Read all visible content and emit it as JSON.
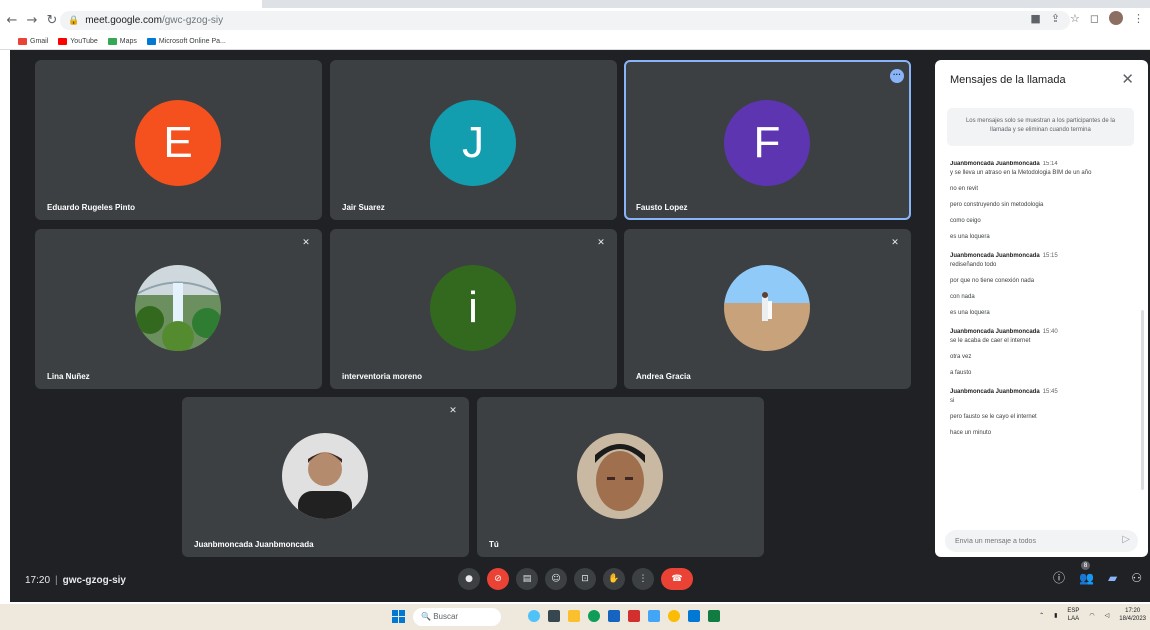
{
  "browser": {
    "url_host": "meet.google.com",
    "url_path": "/gwc-gzog-siy",
    "bookmarks": [
      {
        "label": "Gmail",
        "color": "#ea4335"
      },
      {
        "label": "YouTube",
        "color": "#ff0000"
      },
      {
        "label": "Maps",
        "color": "#34a853"
      },
      {
        "label": "Microsoft Online Pa...",
        "color": "#0078d4"
      }
    ]
  },
  "participants": {
    "eduardo": {
      "name": "Eduardo Rugeles Pinto",
      "initial": "E",
      "color": "#f4511e"
    },
    "jair": {
      "name": "Jair Suarez",
      "initial": "J",
      "color": "#129eaf"
    },
    "fausto": {
      "name": "Fausto Lopez",
      "initial": "F",
      "color": "#5e35b1"
    },
    "lina": {
      "name": "Lina Nuñez"
    },
    "interventoria": {
      "name": "interventoria moreno",
      "initial": "i",
      "color": "#33691e"
    },
    "andrea": {
      "name": "Andrea Gracia"
    },
    "juanbmoncada": {
      "name": "Juanbmoncada Juanbmoncada"
    },
    "tu": {
      "name": "Tú"
    }
  },
  "chat": {
    "title": "Mensajes de la llamada",
    "note": "Los mensajes solo se muestran a los participantes de la llamada y se eliminan cuando termina",
    "groups": [
      {
        "sender": "Juanbmoncada Juanbmoncada",
        "time": "15:14",
        "lines": [
          "y se lleva un atraso en la Metodologia BIM de un año",
          "no en revit",
          "pero construyendo sin metodologia",
          "como ceigo",
          "es una loquera"
        ]
      },
      {
        "sender": "Juanbmoncada Juanbmoncada",
        "time": "15:15",
        "lines": [
          "rediseñando todo",
          "por que no tiene conexión nada",
          "con nada",
          "es una loquera"
        ]
      },
      {
        "sender": "Juanbmoncada Juanbmoncada",
        "time": "15:40",
        "lines": [
          "se le acaba de caer el internet",
          "otra vez",
          "a fausto"
        ]
      },
      {
        "sender": "Juanbmoncada Juanbmoncada",
        "time": "15:45",
        "lines": [
          "si",
          "pero fausto se le cayo el internet",
          "hace un minuto"
        ]
      }
    ],
    "input_placeholder": "Envía un mensaje a todos"
  },
  "meeting": {
    "clock": "17:20",
    "code": "gwc-gzog-siy",
    "people_count": "8"
  },
  "taskbar": {
    "search_label": "Buscar",
    "lang_top": "ESP",
    "lang_bottom": "LAA",
    "clock_time": "17:20",
    "clock_date": "18/4/2023"
  }
}
